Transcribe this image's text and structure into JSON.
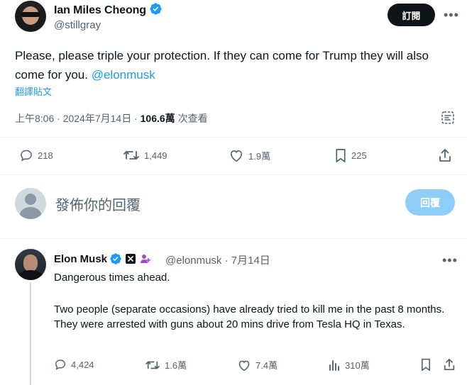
{
  "tweet": {
    "author_name": "Ian Miles Cheong",
    "author_handle": "@stillgray",
    "subscribe_label": "訂閱",
    "more_label": "•••",
    "text_main": "Please, please triple your protection. If they can come for Trump they will also come for you. ",
    "mention": "@elonmusk",
    "translate_label": "翻譯貼文",
    "timestamp": "上午8:06 · 2024年7月14日 · ",
    "views_count": "106.6萬",
    "views_label": " 次查看",
    "actions": {
      "replies": "218",
      "retweets": "1,449",
      "likes": "1.9萬",
      "bookmarks": "225"
    }
  },
  "composer": {
    "placeholder": "發佈你的回覆",
    "reply_button": "回覆"
  },
  "reply": {
    "author_name": "Elon Musk",
    "handle_and_date": "@elonmusk · 7月14日",
    "more_label": "•••",
    "text_line1": "Dangerous times ahead.",
    "text_line2": "Two people (separate occasions) have already tried to kill me in the past 8 months. They were arrested with guns about 20 mins drive from Tesla HQ in Texas.",
    "actions": {
      "replies": "4,424",
      "retweets": "1.6萬",
      "likes": "7.4萬",
      "views": "310萬"
    }
  },
  "colors": {
    "accent": "#1d9bf0",
    "verified": "#1d9bf0",
    "muted": "#536471",
    "reply_button_disabled": "#8ecdf7"
  }
}
